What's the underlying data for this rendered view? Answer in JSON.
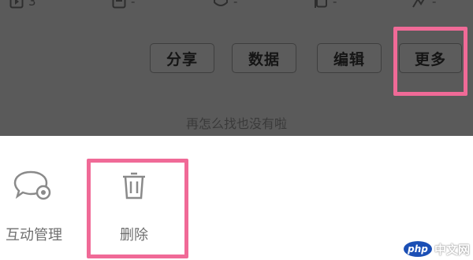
{
  "stats": [
    {
      "icon": "play-icon",
      "value": "3"
    },
    {
      "icon": "comment-icon",
      "value": "-"
    },
    {
      "icon": "shield-icon",
      "value": "-"
    },
    {
      "icon": "copy-icon",
      "value": "-"
    },
    {
      "icon": "like-icon",
      "value": "-"
    }
  ],
  "actions": {
    "share_label": "分享",
    "data_label": "数据",
    "edit_label": "编辑",
    "more_label": "更多"
  },
  "end_text": "再怎么找也没有啦",
  "sheet": {
    "items": [
      {
        "label": "互动管理",
        "icon": "chat-gear-icon"
      },
      {
        "label": "删除",
        "icon": "trash-icon"
      }
    ]
  },
  "colors": {
    "overlay": "#5a5a5a",
    "highlight": "#f06a97",
    "sheet": "#ffffff"
  },
  "watermark": {
    "logo": "php",
    "text": "中文网"
  }
}
